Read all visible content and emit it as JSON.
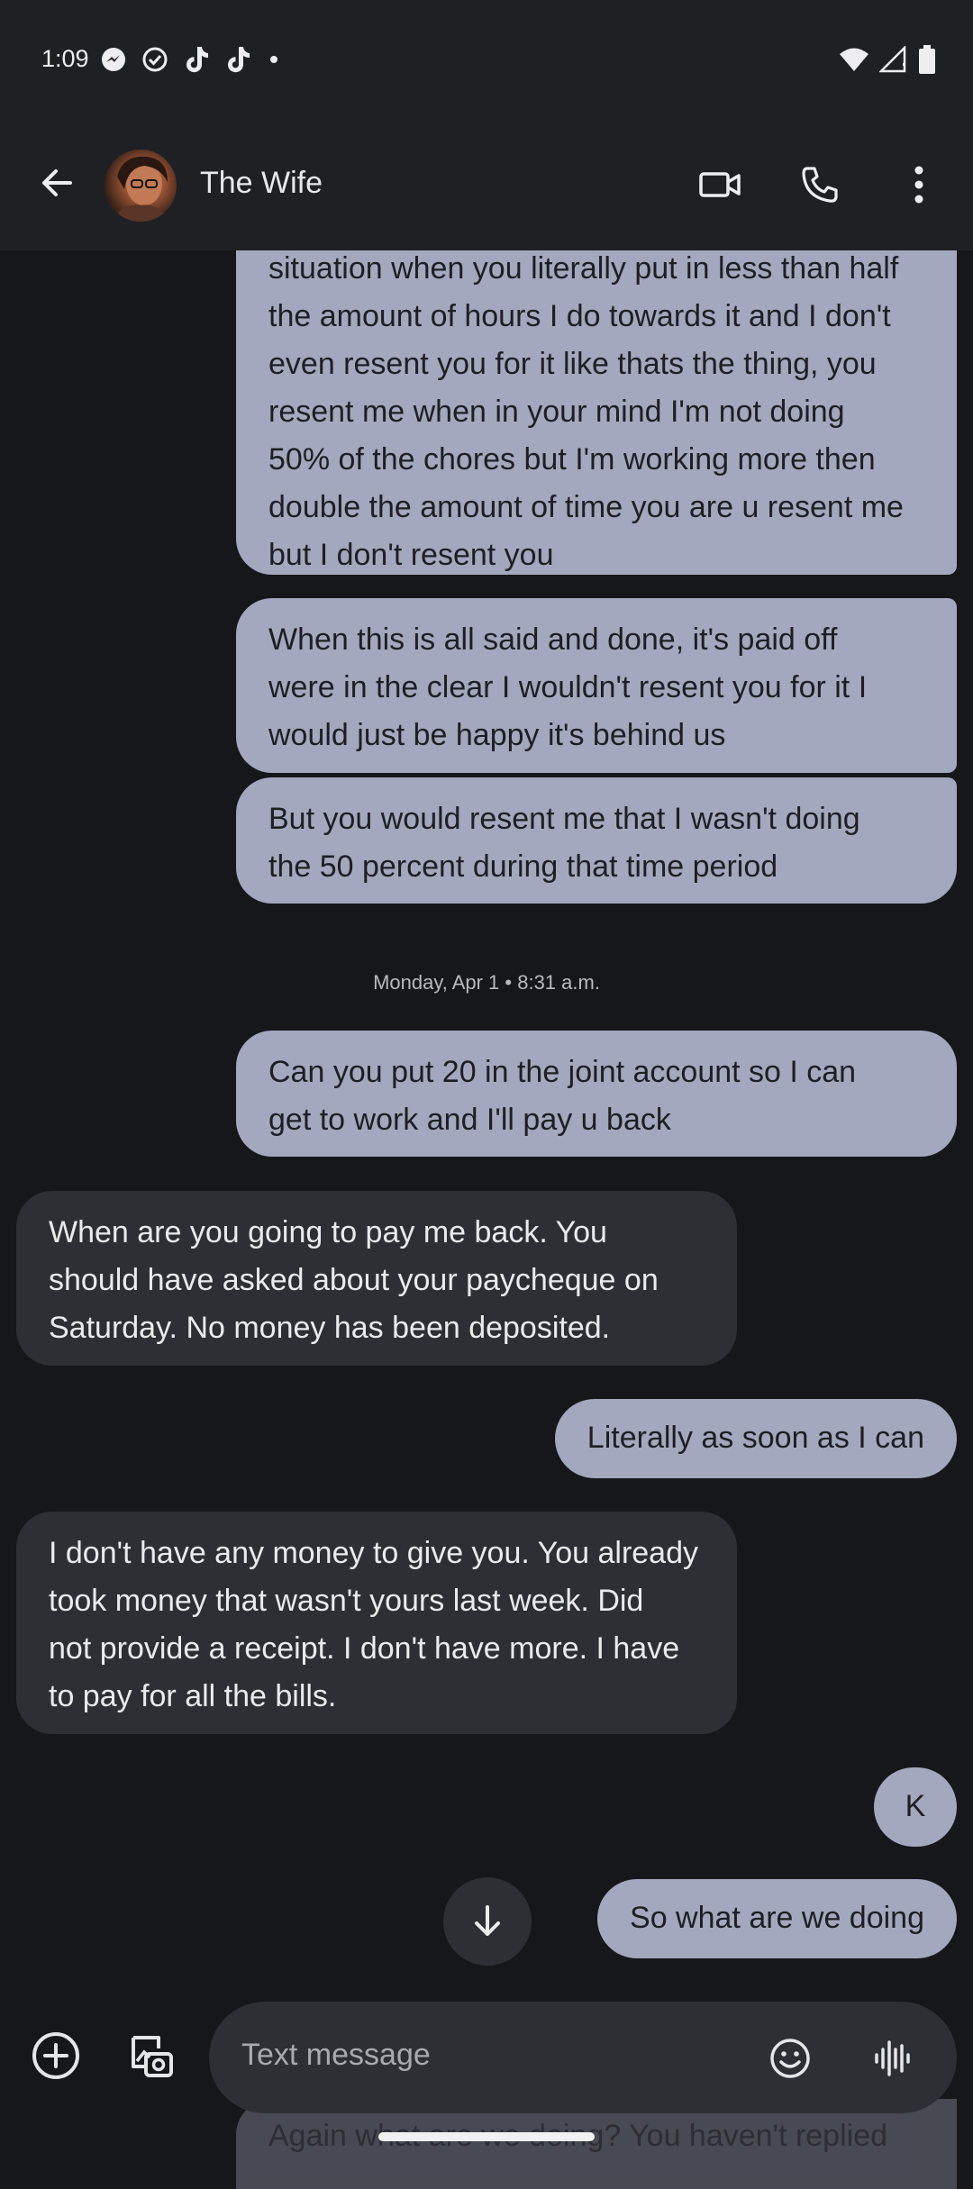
{
  "status_bar": {
    "time": "1:09",
    "left_icons": [
      "messenger-icon",
      "check-circle-icon",
      "tiktok-icon",
      "tiktok-icon",
      "dot-icon"
    ],
    "right_icons": [
      "wifi-icon",
      "signal-icon",
      "battery-icon"
    ]
  },
  "header": {
    "contact_name": "The Wife",
    "back_icon": "arrow-left-icon",
    "actions": [
      "video-call-icon",
      "phone-icon",
      "more-vert-icon"
    ]
  },
  "messages": [
    {
      "direction": "out",
      "text": "situation when you literally put in less than half\nthe amount of hours I do towards it and I don't\neven resent you for it like thats the thing, you\nresent me when in your mind I'm not doing\n50% of the chores but I'm working more then\ndouble the amount of time you are u resent me\nbut I don't resent you"
    },
    {
      "direction": "out",
      "text": "When this is all said and done, it's paid off\nwere in the clear I wouldn't resent you for it I\nwould just be happy it's behind us"
    },
    {
      "direction": "out",
      "text": "But you would resent me that I wasn't doing\nthe 50 percent during that time period"
    },
    {
      "direction": "out",
      "text": "Can you put 20 in the joint account so I can\nget to work and I'll pay u back"
    },
    {
      "direction": "in",
      "text": "When are you going to pay me back. You\nshould have asked about your paycheque on\nSaturday. No money has been deposited."
    },
    {
      "direction": "out",
      "text": "Literally as soon as I can"
    },
    {
      "direction": "in",
      "text": "I don't have any money to give you. You already\ntook money that wasn't yours last week. Did\nnot provide a receipt. I don't have more. I have\nto pay for all the bills."
    },
    {
      "direction": "out",
      "text": "K"
    },
    {
      "direction": "out",
      "text": "So what are we doing"
    },
    {
      "direction": "out",
      "text": "Again what are we doing? You haven't replied"
    }
  ],
  "timestamp": "Monday, Apr 1 • 8:31 a.m.",
  "compose": {
    "placeholder": "Text message",
    "icons": [
      "add-circle-icon",
      "gallery-icon",
      "emoji-icon",
      "voice-icon"
    ]
  },
  "colors": {
    "outgoing_bubble": "#a4a8be",
    "incoming_bubble": "#2e2f34",
    "background": "#16171b",
    "app_bar": "#1f2024"
  }
}
